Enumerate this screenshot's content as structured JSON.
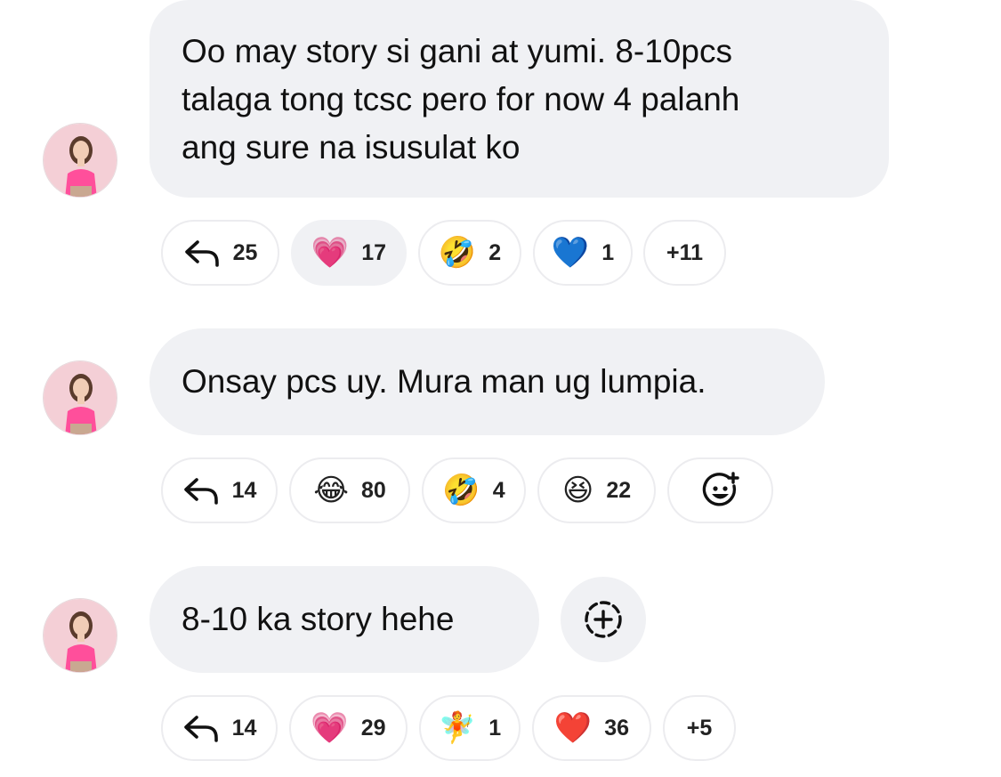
{
  "comments": [
    {
      "text": "Oo may story si gani at yumi. 8-10pcs\ntalaga tong tcsc pero for now 4 palanh\nang sure na isusulat ko",
      "reply_count": "25",
      "reactions": [
        {
          "emoji": "💗",
          "icon": "growing-heart-emoji",
          "count": "17"
        },
        {
          "emoji": "🤣",
          "icon": "rofl-emoji",
          "count": "2"
        },
        {
          "emoji": "💙",
          "icon": "blue-heart-emoji",
          "count": "1"
        }
      ],
      "more": "+11"
    },
    {
      "text": "Onsay pcs uy. Mura man ug lumpia.",
      "reply_count": "14",
      "reactions": [
        {
          "emoji": "😂",
          "icon": "tears-of-joy-emoji",
          "count": "80"
        },
        {
          "emoji": "🤣",
          "icon": "rofl-emoji",
          "count": "4"
        },
        {
          "emoji": "😆",
          "icon": "laughing-emoji",
          "count": "22"
        }
      ],
      "add_reaction_icon": "add-reaction-icon"
    },
    {
      "text": "8-10 ka story hehe",
      "reply_count": "14",
      "reactions": [
        {
          "emoji": "💗",
          "icon": "growing-heart-emoji",
          "count": "29"
        },
        {
          "emoji": "🧚",
          "icon": "fairy-emoji",
          "count": "1"
        },
        {
          "emoji": "❤️",
          "icon": "red-heart-emoji",
          "count": "36"
        }
      ],
      "more": "+5",
      "add_reaction_icon": "dashed-add-circle-icon"
    }
  ],
  "colors": {
    "bubble_bg": "#f0f1f4",
    "pill_border": "#ececef",
    "text": "#111111",
    "avatar_bg": "#f3c9d2",
    "avatar_top": "#ff5fa2"
  }
}
